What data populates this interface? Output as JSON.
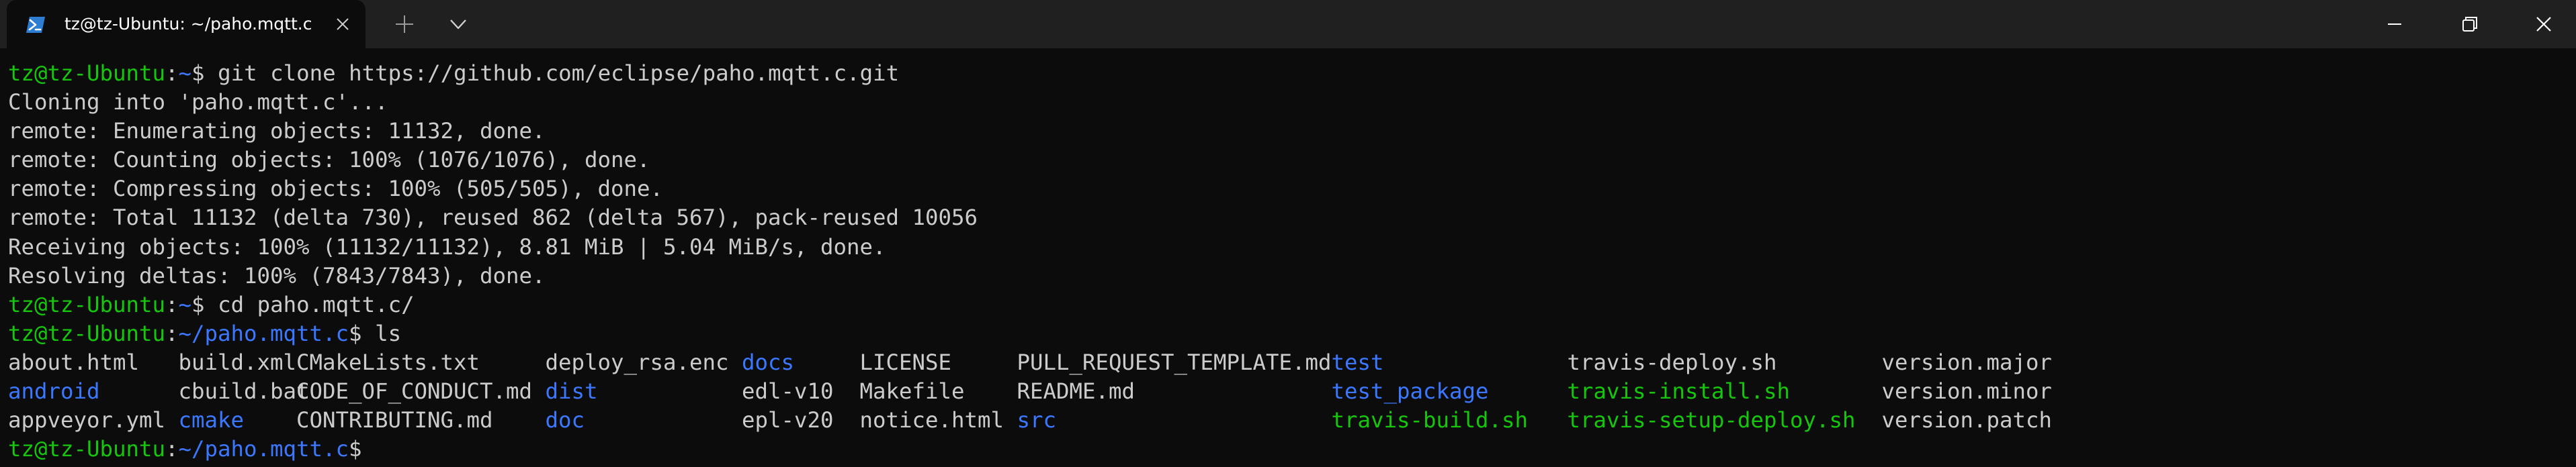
{
  "window": {
    "tab_title": "tz@tz-Ubuntu: ~/paho.mqtt.c",
    "tab_icon": "powershell-icon",
    "background": "#0c0c0c",
    "titlebar_color": "#202020"
  },
  "colors": {
    "prompt_user": "#16c60c",
    "prompt_path": "#3b78ff",
    "text": "#cccccc",
    "directory": "#3b78ff",
    "executable": "#16c60c"
  },
  "terminal": {
    "lines": [
      {
        "kind": "prompt",
        "user": "tz@tz-Ubuntu",
        "sep": ":",
        "path": "~",
        "symbol": "$",
        "cmd": " git clone https://github.com/eclipse/paho.mqtt.c.git"
      },
      {
        "kind": "output",
        "text": "Cloning into 'paho.mqtt.c'..."
      },
      {
        "kind": "output",
        "text": "remote: Enumerating objects: 11132, done."
      },
      {
        "kind": "output",
        "text": "remote: Counting objects: 100% (1076/1076), done."
      },
      {
        "kind": "output",
        "text": "remote: Compressing objects: 100% (505/505), done."
      },
      {
        "kind": "output",
        "text": "remote: Total 11132 (delta 730), reused 862 (delta 567), pack-reused 10056"
      },
      {
        "kind": "output",
        "text": "Receiving objects: 100% (11132/11132), 8.81 MiB | 5.04 MiB/s, done."
      },
      {
        "kind": "output",
        "text": "Resolving deltas: 100% (7843/7843), done."
      },
      {
        "kind": "prompt",
        "user": "tz@tz-Ubuntu",
        "sep": ":",
        "path": "~",
        "symbol": "$",
        "cmd": " cd paho.mqtt.c/"
      },
      {
        "kind": "prompt",
        "user": "tz@tz-Ubuntu",
        "sep": ":",
        "path": "~/paho.mqtt.c",
        "symbol": "$",
        "cmd": " ls"
      },
      {
        "kind": "ls",
        "cells": [
          {
            "text": "about.html",
            "type": "file"
          },
          {
            "text": "build.xml",
            "type": "file"
          },
          {
            "text": "CMakeLists.txt",
            "type": "file"
          },
          {
            "text": "deploy_rsa.enc",
            "type": "file"
          },
          {
            "text": "docs",
            "type": "dir"
          },
          {
            "text": "LICENSE",
            "type": "file"
          },
          {
            "text": "PULL_REQUEST_TEMPLATE.md",
            "type": "file"
          },
          {
            "text": "test",
            "type": "dir"
          },
          {
            "text": "travis-deploy.sh",
            "type": "file"
          },
          {
            "text": "version.major",
            "type": "file"
          }
        ]
      },
      {
        "kind": "ls",
        "cells": [
          {
            "text": "android",
            "type": "dir"
          },
          {
            "text": "cbuild.bat",
            "type": "file"
          },
          {
            "text": "CODE_OF_CONDUCT.md",
            "type": "file"
          },
          {
            "text": "dist",
            "type": "dir"
          },
          {
            "text": "edl-v10",
            "type": "file"
          },
          {
            "text": "Makefile",
            "type": "file"
          },
          {
            "text": "README.md",
            "type": "file"
          },
          {
            "text": "test_package",
            "type": "dir"
          },
          {
            "text": "travis-install.sh",
            "type": "exec"
          },
          {
            "text": "version.minor",
            "type": "file"
          }
        ]
      },
      {
        "kind": "ls",
        "cells": [
          {
            "text": "appveyor.yml",
            "type": "file"
          },
          {
            "text": "cmake",
            "type": "dir"
          },
          {
            "text": "CONTRIBUTING.md",
            "type": "file"
          },
          {
            "text": "doc",
            "type": "dir"
          },
          {
            "text": "epl-v20",
            "type": "file"
          },
          {
            "text": "notice.html",
            "type": "file"
          },
          {
            "text": "src",
            "type": "dir"
          },
          {
            "text": "travis-build.sh",
            "type": "exec"
          },
          {
            "text": "travis-setup-deploy.sh",
            "type": "exec"
          },
          {
            "text": "version.patch",
            "type": "file"
          }
        ]
      },
      {
        "kind": "prompt",
        "user": "tz@tz-Ubuntu",
        "sep": ":",
        "path": "~/paho.mqtt.c",
        "symbol": "$",
        "cmd": ""
      }
    ]
  }
}
